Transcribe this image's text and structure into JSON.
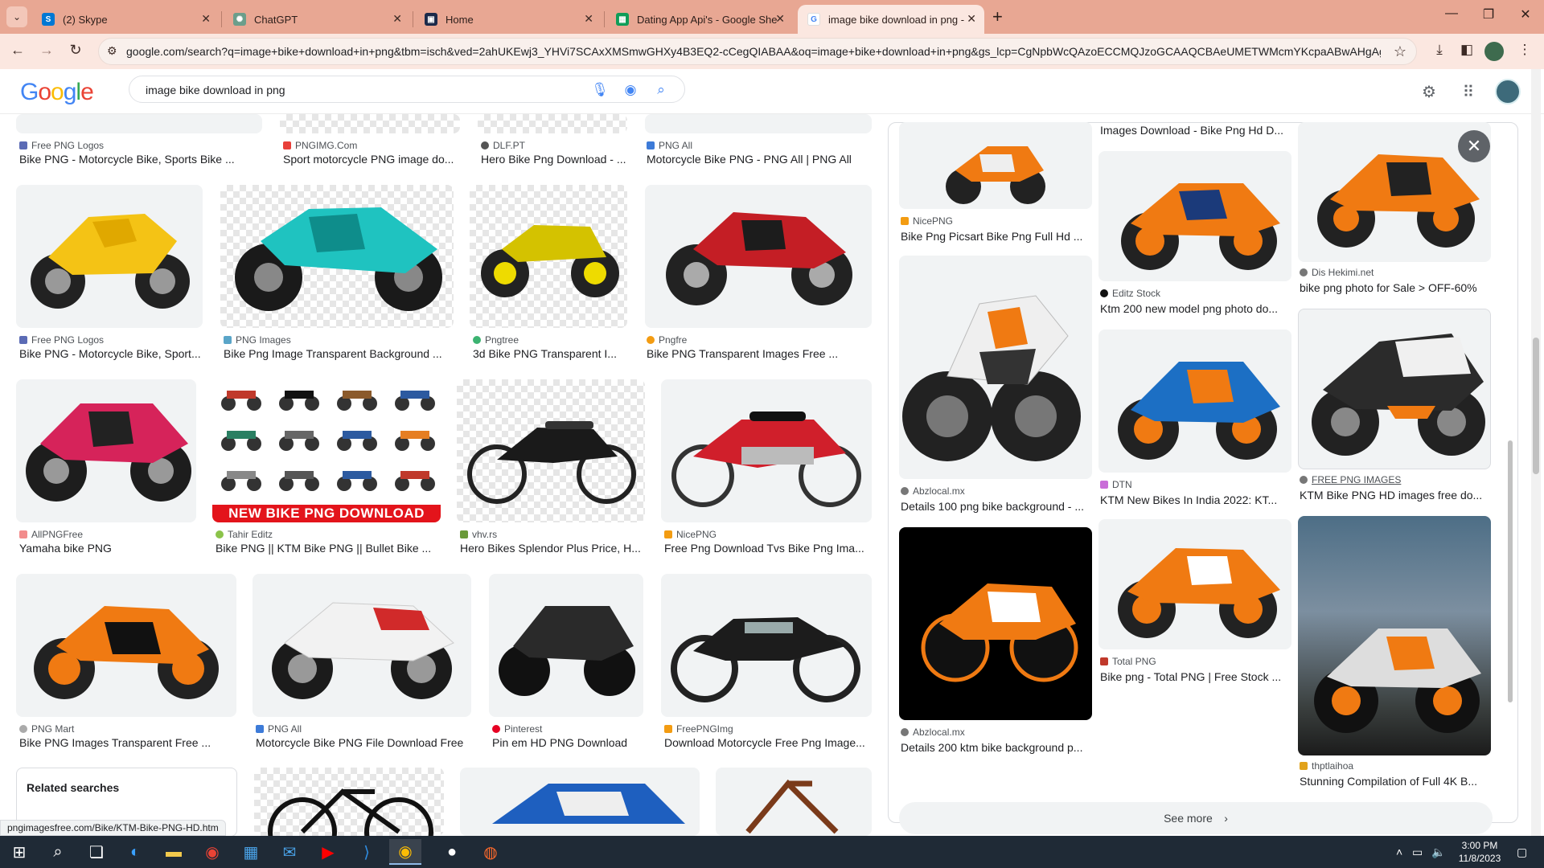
{
  "browser": {
    "tabs": [
      {
        "label": "(2) Skype",
        "icon": "skype-icon",
        "color": "#0078d4"
      },
      {
        "label": "ChatGPT",
        "icon": "chatgpt-icon",
        "color": "#6b9e8b"
      },
      {
        "label": "Home",
        "icon": "home-icon",
        "color": "#1b2a4a"
      },
      {
        "label": "Dating App Api's - Google She",
        "icon": "sheets-icon",
        "color": "#0f9d58"
      },
      {
        "label": "image bike download in png -",
        "icon": "google-icon",
        "color": "#ffffff",
        "active": true
      }
    ],
    "url": "google.com/search?q=image+bike+download+in+png&tbm=isch&ved=2ahUKEwj3_YHVi7SCAxXMSmwGHXy4B3EQ2-cCegQIABAA&oq=image+bike+download+in+png&gs_lcp=CgNpbWcQAzoECCMQJzoGCAAQCBAeUMETWMcmYKcpaABwAHgAgA..."
  },
  "google": {
    "logo": [
      "G",
      "o",
      "o",
      "g",
      "l",
      "e"
    ],
    "logo_colors": [
      "#4285f4",
      "#ea4335",
      "#fbbc05",
      "#4285f4",
      "#34a853",
      "#ea4335"
    ],
    "query": "image bike download in png"
  },
  "results": {
    "row0": [
      {
        "source": "Free PNG Logos",
        "title": "Bike PNG - Motorcycle Bike, Sports Bike ..."
      },
      {
        "source": "PNGIMG.Com",
        "title": "Sport motorcycle PNG image do..."
      },
      {
        "source": "DLF.PT",
        "title": "Hero Bike Png Download - ..."
      },
      {
        "source": "PNG All",
        "title": "Motorcycle Bike PNG - PNG All | PNG All"
      }
    ],
    "row1": [
      {
        "source": "Free PNG Logos",
        "title": "Bike PNG - Motorcycle Bike, Sport..."
      },
      {
        "source": "PNG Images",
        "title": "Bike Png Image Transparent Background ..."
      },
      {
        "source": "Pngtree",
        "title": "3d Bike PNG Transparent I..."
      },
      {
        "source": "Pngfre",
        "title": "Bike PNG Transparent Images Free ..."
      }
    ],
    "row2": [
      {
        "source": "AllPNGFree",
        "title": "Yamaha bike PNG"
      },
      {
        "source": "Tahir Editz",
        "title": "Bike PNG || KTM Bike PNG || Bullet Bike ...",
        "banner": "NEW BIKE PNG DOWNLOAD"
      },
      {
        "source": "vhv.rs",
        "title": "Hero Bikes Splendor Plus Price, H..."
      },
      {
        "source": "NicePNG",
        "title": "Free Png Download Tvs Bike Png Ima..."
      }
    ],
    "row3": [
      {
        "source": "PNG Mart",
        "title": "Bike PNG Images Transparent Free ..."
      },
      {
        "source": "PNG All",
        "title": "Motorcycle Bike PNG File Download Free"
      },
      {
        "source": "Pinterest",
        "title": "Pin em HD PNG Download"
      },
      {
        "source": "FreePNGImg",
        "title": "Download Motorcycle Free Png Image..."
      }
    ],
    "related_title": "Related searches"
  },
  "panel": {
    "col1": [
      {
        "source": "NicePNG",
        "title": "Bike Png Picsart Bike Png Full Hd ..."
      },
      {
        "source": "Abzlocal.mx",
        "title": "Details 100 png bike background - ..."
      },
      {
        "source": "Abzlocal.mx",
        "title": "Details 200 ktm bike background p..."
      }
    ],
    "col2": [
      {
        "source": "",
        "title": "Images Download - Bike Png Hd D..."
      },
      {
        "source": "Editz Stock",
        "title": "Ktm 200 new model png photo do..."
      },
      {
        "source": "DTN",
        "title": "KTM New Bikes In India 2022: KT..."
      },
      {
        "source": "Total PNG",
        "title": "Bike png - Total PNG | Free Stock ..."
      }
    ],
    "col3": [
      {
        "source": "Dis Hekimi.net",
        "title": "bike png photo for Sale > OFF-60%"
      },
      {
        "source": "FREE PNG IMAGES",
        "title": "KTM Bike PNG HD images free do..."
      },
      {
        "source": "thptlaihoa",
        "title": "Stunning Compilation of Full 4K B..."
      }
    ],
    "see_more": "See more"
  },
  "status_url": "pngimagesfree.com/Bike/KTM-Bike-PNG-HD.htm",
  "taskbar": {
    "time": "3:00 PM",
    "date": "11/8/2023"
  }
}
